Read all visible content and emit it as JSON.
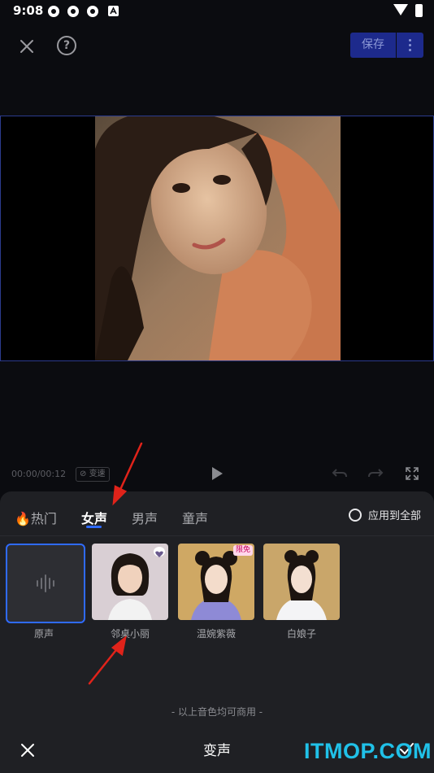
{
  "status_bar": {
    "time": "9:08"
  },
  "toolbar": {
    "save_label": "保存"
  },
  "playback": {
    "time_readout": "00:00/00:12",
    "speed_label": "变速"
  },
  "voice_panel": {
    "tabs": [
      {
        "label": "🔥热门",
        "active": false
      },
      {
        "label": "女声",
        "active": true
      },
      {
        "label": "男声",
        "active": false
      },
      {
        "label": "童声",
        "active": false
      }
    ],
    "apply_all_label": "应用到全部",
    "voices": [
      {
        "label": "原声",
        "selected": true
      },
      {
        "label": "邻桌小丽",
        "badge": "heart"
      },
      {
        "label": "温婉紫薇",
        "badge": "限免"
      },
      {
        "label": "白娘子"
      }
    ],
    "commercial_note": "- 以上音色均可商用 -",
    "title": "变声"
  },
  "watermark": {
    "text": "ITMOP.COM"
  },
  "colors": {
    "accent": "#2f6bff",
    "save_bg": "#1d2a8c",
    "annotation": "#e0231a",
    "watermark": "#20c1e8"
  }
}
